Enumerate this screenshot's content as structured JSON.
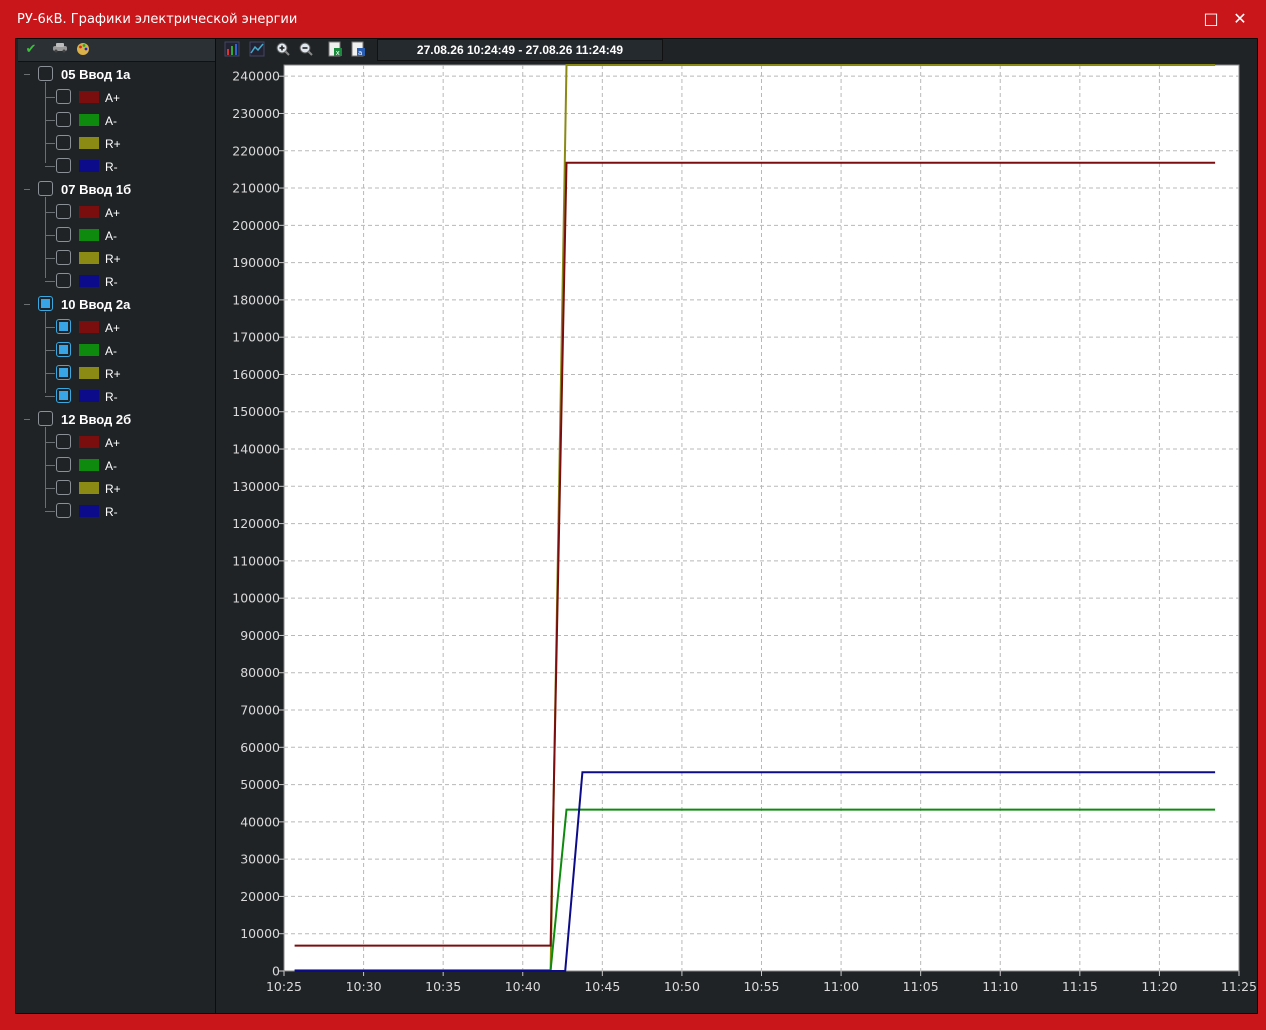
{
  "window": {
    "title": "РУ-6кВ. Графики электрической энергии",
    "maximize_glyph": "□",
    "close_glyph": "✕"
  },
  "toolbar_left": {
    "icons": [
      "check-all-icon",
      "car-icon",
      "palette-icon"
    ]
  },
  "toolbar_right": {
    "icons": [
      "chart-bars-icon",
      "chart-line-icon",
      "zoom-in-icon",
      "zoom-out-icon",
      "export-excel-icon",
      "export-csv-icon"
    ],
    "time_range": "27.08.26 10:24:49 - 27.08.26 11:24:49"
  },
  "tree": [
    {
      "label": "05 Ввод 1а",
      "checked": false,
      "channels": [
        {
          "label": "A+",
          "color": "#7a0e0e",
          "checked": false
        },
        {
          "label": "A-",
          "color": "#0e8a0e",
          "checked": false
        },
        {
          "label": "R+",
          "color": "#8a8a14",
          "checked": false
        },
        {
          "label": "R-",
          "color": "#0c0c8a",
          "checked": false
        }
      ]
    },
    {
      "label": "07 Ввод 1б",
      "checked": false,
      "channels": [
        {
          "label": "A+",
          "color": "#7a0e0e",
          "checked": false
        },
        {
          "label": "A-",
          "color": "#0e8a0e",
          "checked": false
        },
        {
          "label": "R+",
          "color": "#8a8a14",
          "checked": false
        },
        {
          "label": "R-",
          "color": "#0c0c8a",
          "checked": false
        }
      ]
    },
    {
      "label": "10 Ввод 2а",
      "checked": true,
      "channels": [
        {
          "label": "A+",
          "color": "#7a0e0e",
          "checked": true
        },
        {
          "label": "A-",
          "color": "#0e8a0e",
          "checked": true
        },
        {
          "label": "R+",
          "color": "#8a8a14",
          "checked": true
        },
        {
          "label": "R-",
          "color": "#0c0c8a",
          "checked": true
        }
      ]
    },
    {
      "label": "12 Ввод 2б",
      "checked": false,
      "channels": [
        {
          "label": "A+",
          "color": "#7a0e0e",
          "checked": false
        },
        {
          "label": "A-",
          "color": "#0e8a0e",
          "checked": false
        },
        {
          "label": "R+",
          "color": "#8a8a14",
          "checked": false
        },
        {
          "label": "R-",
          "color": "#0c0c8a",
          "checked": false
        }
      ]
    }
  ],
  "chart_data": {
    "type": "line",
    "title": "",
    "xlabel": "",
    "ylabel": "",
    "grid": true,
    "legend": "none",
    "x_unit": "time",
    "xlim": [
      "10:25",
      "11:25"
    ],
    "ylim": [
      0,
      243000
    ],
    "x_ticks": [
      "10:25",
      "10:30",
      "10:35",
      "10:40",
      "10:45",
      "10:50",
      "10:55",
      "11:00",
      "11:05",
      "11:10",
      "11:15",
      "11:20",
      "11:25"
    ],
    "y_ticks": [
      0,
      10000,
      20000,
      30000,
      40000,
      50000,
      60000,
      70000,
      80000,
      90000,
      100000,
      110000,
      120000,
      130000,
      140000,
      150000,
      160000,
      170000,
      180000,
      190000,
      200000,
      210000,
      220000,
      230000,
      240000
    ],
    "series": [
      {
        "channel": "A+",
        "color": "#7a0e0e",
        "points": [
          [
            "10:25:40",
            6800
          ],
          [
            "10:41:45",
            6800
          ],
          [
            "10:42:45",
            216800
          ],
          [
            "11:23:30",
            216800
          ]
        ]
      },
      {
        "channel": "A-",
        "color": "#0e8a0e",
        "points": [
          [
            "10:25:40",
            200
          ],
          [
            "10:41:45",
            200
          ],
          [
            "10:42:45",
            43300
          ],
          [
            "11:23:30",
            43300
          ]
        ]
      },
      {
        "channel": "R+",
        "color": "#8a8a14",
        "points": [
          [
            "10:25:40",
            0
          ],
          [
            "10:41:45",
            0
          ],
          [
            "10:42:45",
            243000
          ],
          [
            "11:23:30",
            243000
          ]
        ]
      },
      {
        "channel": "R-",
        "color": "#0c0c8a",
        "points": [
          [
            "10:25:40",
            0
          ],
          [
            "10:42:40",
            0
          ],
          [
            "10:43:45",
            53300
          ],
          [
            "11:23:30",
            53300
          ]
        ]
      }
    ]
  }
}
